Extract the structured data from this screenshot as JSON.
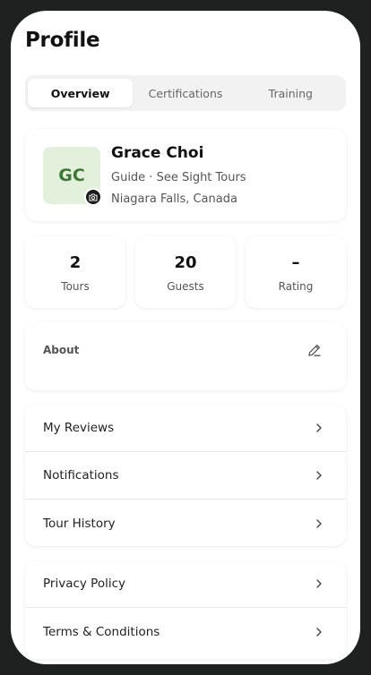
{
  "header": {
    "title": "Profile"
  },
  "tabs": [
    {
      "label": "Overview",
      "active": true
    },
    {
      "label": "Certifications",
      "active": false
    },
    {
      "label": "Training",
      "active": false
    }
  ],
  "profile": {
    "initials": "GC",
    "name": "Grace Choi",
    "role": "Guide · See Sight Tours",
    "location": "Niagara Falls, Canada",
    "avatar_bg": "#e3f0dc",
    "avatar_fg": "#3f7a35"
  },
  "stats": [
    {
      "value": "2",
      "label": "Tours"
    },
    {
      "value": "20",
      "label": "Guests"
    },
    {
      "value": "–",
      "label": "Rating"
    }
  ],
  "about": {
    "label": "About",
    "edit_icon": "pencil-icon"
  },
  "menu_group_1": [
    {
      "label": "My Reviews",
      "icon": "chevron-right-icon"
    },
    {
      "label": "Notifications",
      "icon": "chevron-right-icon"
    },
    {
      "label": "Tour History",
      "icon": "chevron-right-icon"
    }
  ],
  "menu_group_2": [
    {
      "label": "Privacy Policy",
      "icon": "chevron-right-icon"
    },
    {
      "label": "Terms & Conditions",
      "icon": "chevron-right-icon"
    }
  ]
}
